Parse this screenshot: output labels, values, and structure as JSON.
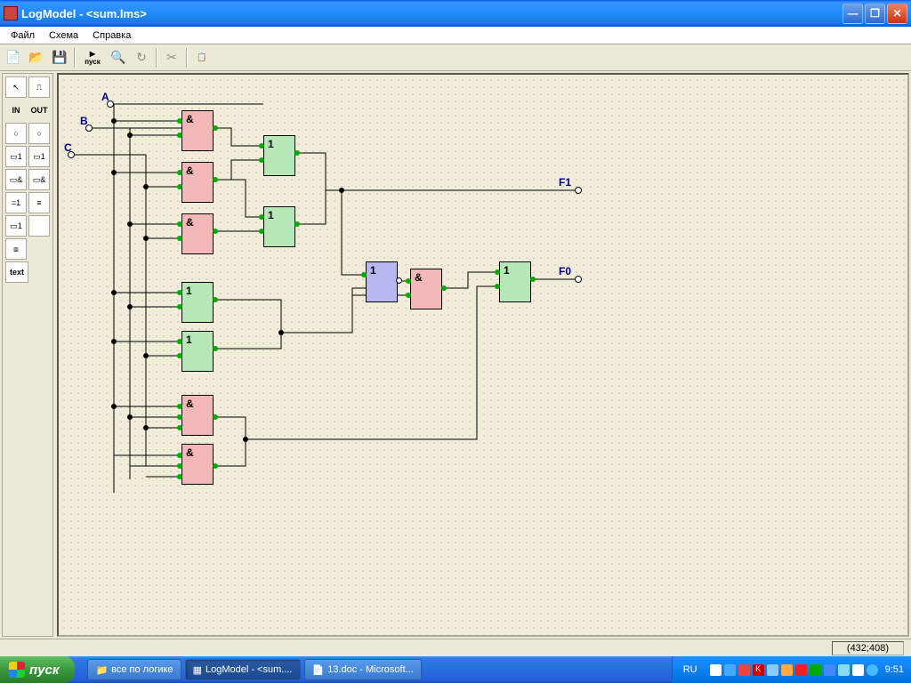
{
  "window": {
    "title": "LogModel - <sum.lms>"
  },
  "menu": {
    "file": "Файл",
    "schema": "Схема",
    "help": "Справка"
  },
  "toolbar": {
    "run_label": "пуск"
  },
  "palette": {
    "in": "IN",
    "out": "OUT",
    "text": "text"
  },
  "canvas": {
    "inputs": {
      "a": "A",
      "b": "B",
      "c": "C"
    },
    "outputs": {
      "f1": "F1",
      "f0": "F0"
    },
    "gates": {
      "and": "&",
      "or": "1"
    }
  },
  "status": {
    "coords": "(432;408)"
  },
  "taskbar": {
    "start": "пуск",
    "items": [
      {
        "icon": "📁",
        "label": "все по логике"
      },
      {
        "icon": "▦",
        "label": "LogModel - <sum...."
      },
      {
        "icon": "📄",
        "label": "13.doc - Microsoft..."
      }
    ],
    "lang": "RU",
    "clock": "9:51"
  }
}
